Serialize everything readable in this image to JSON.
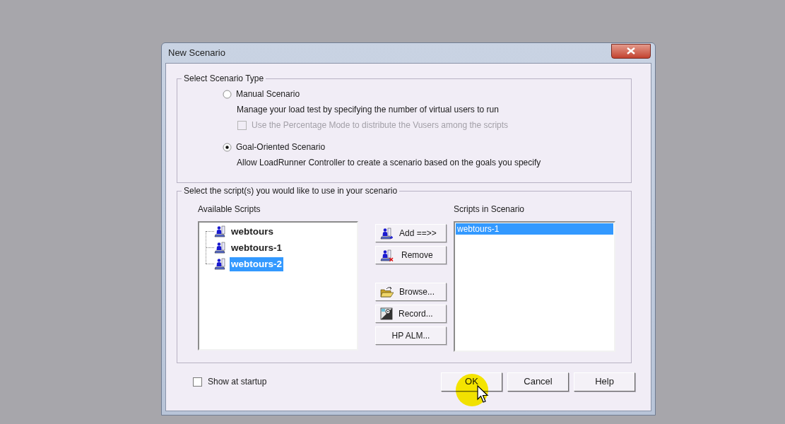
{
  "window": {
    "title": "New Scenario"
  },
  "scenario_type": {
    "legend": "Select Scenario Type",
    "options": [
      {
        "label": "Manual Scenario",
        "selected": false,
        "description": "Manage your load test by specifying the number of virtual users to run",
        "option_checkbox": {
          "label": "Use the Percentage Mode to distribute the Vusers among the scripts",
          "checked": false,
          "disabled": true
        }
      },
      {
        "label": "Goal-Oriented Scenario",
        "selected": true,
        "description": "Allow LoadRunner Controller to create a scenario based on the goals you specify"
      }
    ]
  },
  "scripts": {
    "legend": "Select the script(s) you would like to use in your scenario",
    "available": {
      "label": "Available Scripts",
      "items": [
        {
          "label": "webtours",
          "selected": false
        },
        {
          "label": "webtours-1",
          "selected": false
        },
        {
          "label": "webtours-2",
          "selected": true
        }
      ]
    },
    "button_groups": [
      [
        {
          "label": "Add ==>>",
          "kind": "add"
        },
        {
          "label": "Remove",
          "kind": "remove"
        }
      ],
      [
        {
          "label": "Browse...",
          "kind": "browse"
        },
        {
          "label": "Record...",
          "kind": "record"
        },
        {
          "label": "HP ALM...",
          "kind": "plain"
        }
      ]
    ],
    "in_scenario": {
      "label": "Scripts in Scenario",
      "items": [
        {
          "label": "webtours-1",
          "selected": true
        }
      ]
    }
  },
  "show_at_startup": {
    "label": "Show at startup",
    "checked": false
  },
  "dialog_buttons": [
    {
      "label": "OK"
    },
    {
      "label": "Cancel"
    },
    {
      "label": "Help"
    }
  ]
}
